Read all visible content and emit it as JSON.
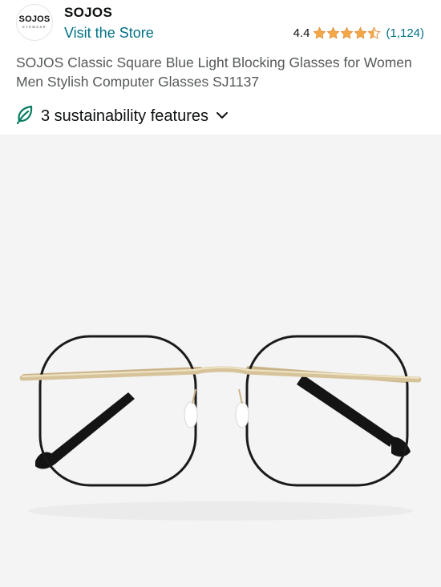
{
  "header": {
    "logo": {
      "main": "SOJOS",
      "sub": "EYEWEAR"
    },
    "brand_name": "SOJOS",
    "visit_store": "Visit the Store",
    "rating": {
      "value": "4.4",
      "stars": 4.5,
      "count": "(1,124)",
      "star_color": "#f3a847"
    }
  },
  "product": {
    "title": "SOJOS Classic Square Blue Light Blocking Glasses for Women Men Stylish Computer Glasses SJ1137"
  },
  "sustainability": {
    "label": "3 sustainability features",
    "icon": "leaf-icon",
    "toggle_icon": "chevron-down-icon",
    "icon_color": "#067d62"
  },
  "image": {
    "subject": "glasses-image",
    "background": "#f4f4f4"
  },
  "colors": {
    "link": "#007185",
    "text": "#0f1111",
    "muted_text": "#565959"
  }
}
